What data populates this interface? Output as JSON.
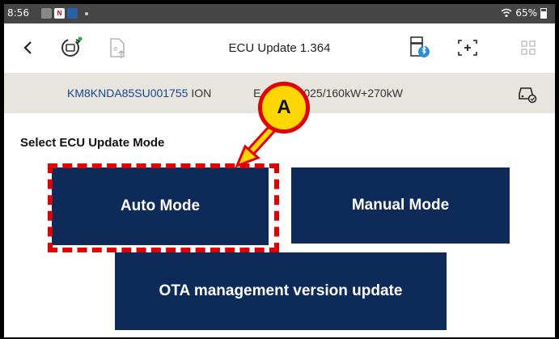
{
  "status_bar": {
    "time": "8:56",
    "battery": "65%",
    "notification_icons": [
      "image-icon",
      "calendar-icon",
      "app-icon"
    ]
  },
  "header": {
    "title": "ECU Update 1.364"
  },
  "vehicle": {
    "vin": "KM8KNDA85SU001755",
    "description": "ION",
    "description_tail": "E EV N)/2025/160kW+270kW"
  },
  "content": {
    "section_label": "Select ECU Update Mode",
    "buttons": {
      "auto": "Auto Mode",
      "manual": "Manual Mode",
      "ota": "OTA management version update"
    }
  },
  "annotation": {
    "callout_label": "A",
    "colors": {
      "highlight": "#e00000",
      "callout_fill": "#ffd700"
    }
  },
  "colors": {
    "button_bg": "#0e2a58",
    "vin_bar_bg": "#e8e4de",
    "vin_text": "#15468a"
  }
}
